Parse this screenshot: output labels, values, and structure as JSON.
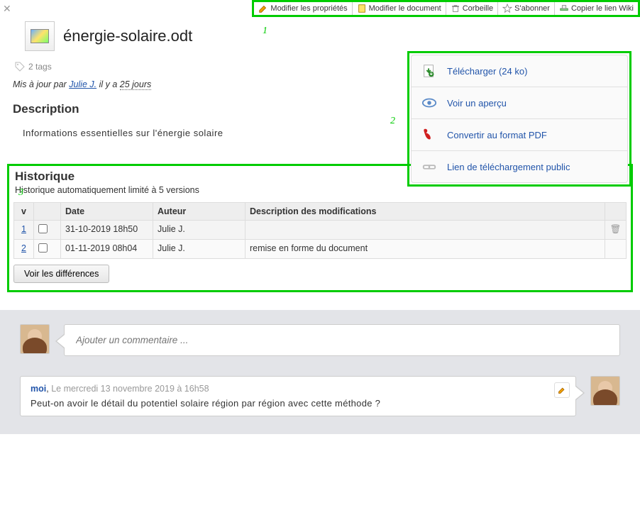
{
  "toolbar": {
    "modify_props": "Modifier les propriétés",
    "modify_doc": "Modifier le document",
    "trash": "Corbeille",
    "subscribe": "S'abonner",
    "copy_wiki": "Copier le lien Wiki"
  },
  "markers": {
    "m1": "1",
    "m2": "2",
    "m3": "3"
  },
  "document": {
    "title": "énergie-solaire.odt",
    "tags_label": "2 tags",
    "updated_prefix": "Mis à jour par ",
    "updated_author": "Julie J.",
    "updated_middle": " il y a ",
    "updated_age": "25 jours"
  },
  "description": {
    "heading": "Description",
    "body": "Informations essentielles sur l'énergie solaire"
  },
  "actions": {
    "download": "Télécharger (24 ko)",
    "preview": "Voir un aperçu",
    "pdf": "Convertir au format PDF",
    "publiclink": "Lien de téléchargement public"
  },
  "history": {
    "title": "Historique",
    "subtitle": "Historique automatiquement limité à 5 versions",
    "headers": {
      "v": "v",
      "date": "Date",
      "author": "Auteur",
      "desc": "Description des modifications"
    },
    "rows": [
      {
        "v": "1",
        "date": "31-10-2019 18h50",
        "author": "Julie J.",
        "desc": ""
      },
      {
        "v": "2",
        "date": "01-11-2019 08h04",
        "author": "Julie J.",
        "desc": "remise en forme du document"
      }
    ],
    "diff_button": "Voir les différences"
  },
  "comments": {
    "placeholder": "Ajouter un commentaire ...",
    "entries": [
      {
        "author": "moi",
        "sep": ", ",
        "time": "Le mercredi 13 novembre 2019 à 16h58",
        "body": "Peut-on avoir le détail du potentiel solaire région par région avec cette méthode ?"
      }
    ]
  }
}
